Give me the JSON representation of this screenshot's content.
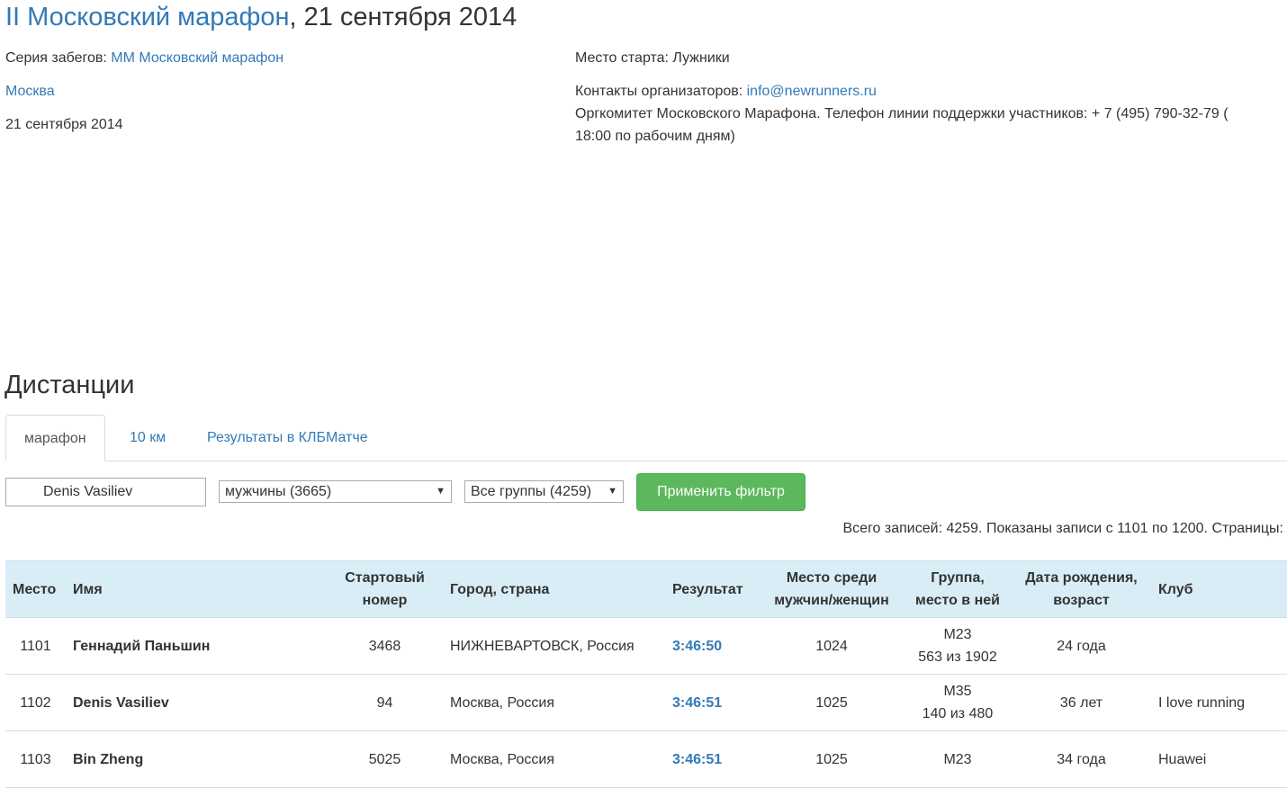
{
  "event": {
    "title_link": "II Московский марафон",
    "title_date": ", 21 сентября 2014",
    "series_label": "Серия забегов: ",
    "series_link": "ММ Московский марафон",
    "city_link": "Москва",
    "date": "21 сентября 2014",
    "start_place": "Место старта: Лужники",
    "contacts_label": "Контакты организаторов: ",
    "contacts_email": "info@newrunners.ru",
    "organizer_line1": "Оргкомитет Московского Марафона. Телефон линии поддержки участников: + 7 (495) 790-32-79 (",
    "organizer_line2": "18:00 по рабочим дням)"
  },
  "distances": {
    "heading": "Дистанции",
    "tabs": [
      {
        "label": "марафон",
        "active": true
      },
      {
        "label": "10 км",
        "active": false
      },
      {
        "label": "Результаты в КЛБМатче",
        "active": false
      }
    ]
  },
  "filters": {
    "name_value": "Denis Vasiliev",
    "gender_selected": "мужчины (3665)",
    "group_selected": "Все группы (4259)",
    "apply_label": "Применить фильтр"
  },
  "records_summary": "Всего записей: 4259. Показаны записи с 1101 по 1200. Страницы:",
  "table": {
    "headers": {
      "place": "Место",
      "name": "Имя",
      "bib_1": "Стартовый",
      "bib_2": "номер",
      "city": "Город, страна",
      "result": "Результат",
      "gender_place_1": "Место среди",
      "gender_place_2": "мужчин/женщин",
      "group_1": "Группа,",
      "group_2": "место в ней",
      "birth_1": "Дата рождения,",
      "birth_2": "возраст",
      "club": "Клуб"
    },
    "rows": [
      {
        "place": "1101",
        "name": "Геннадий Паньшин",
        "bib": "3468",
        "city": "НИЖНЕВАРТОВСК, Россия",
        "result": "3:46:50",
        "gender_place": "1024",
        "group": "М23",
        "group_place": "563 из 1902",
        "age": "24 года",
        "club": ""
      },
      {
        "place": "1102",
        "name": "Denis Vasiliev",
        "bib": "94",
        "city": "Москва, Россия",
        "result": "3:46:51",
        "gender_place": "1025",
        "group": "М35",
        "group_place": "140 из 480",
        "age": "36 лет",
        "club": "I love running"
      },
      {
        "place": "1103",
        "name": "Bin Zheng",
        "bib": "5025",
        "city": "Москва, Россия",
        "result": "3:46:51",
        "gender_place": "1025",
        "group": "М23",
        "group_place": "",
        "age": "34 года",
        "club": "Huawei"
      }
    ]
  }
}
